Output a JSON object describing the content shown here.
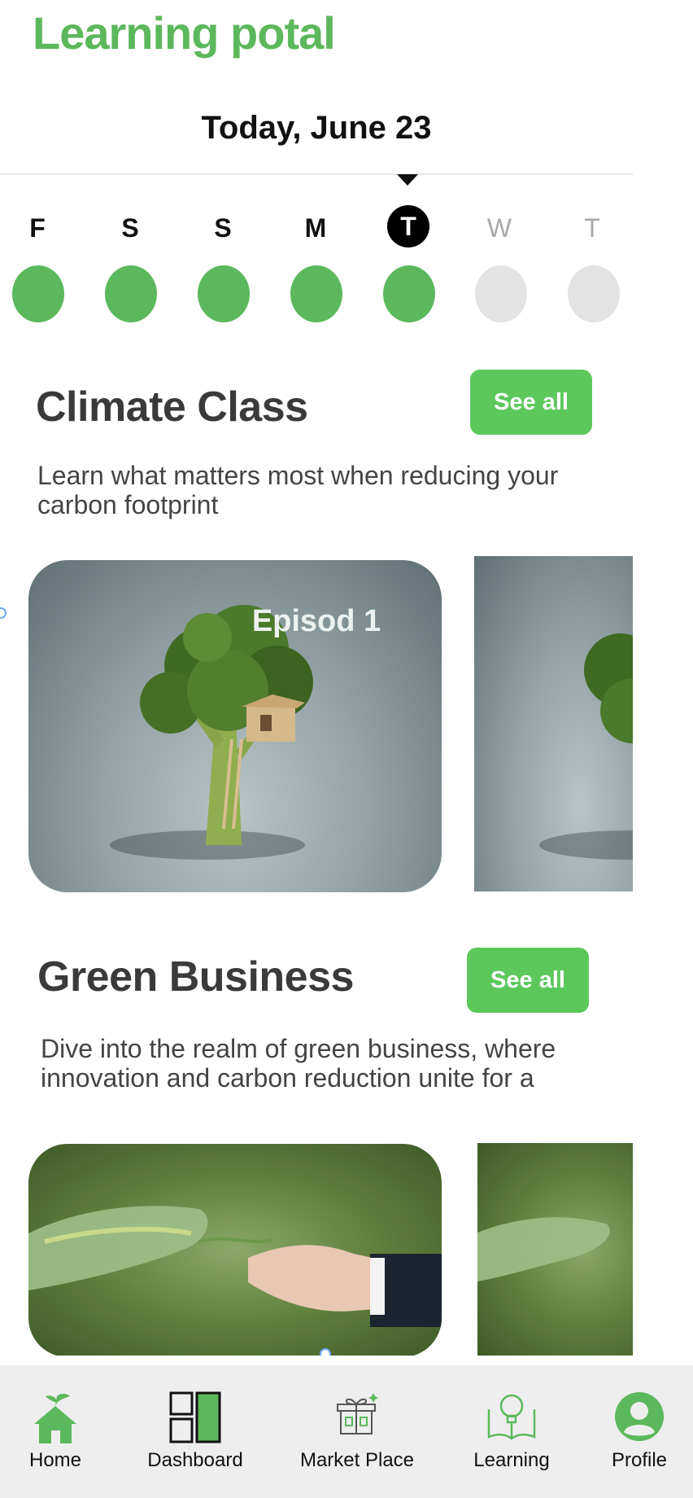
{
  "header": {
    "app_title": "Learning potal",
    "date": "Today, June 23"
  },
  "week": {
    "days": [
      {
        "letter": "F",
        "done": true
      },
      {
        "letter": "S",
        "done": true
      },
      {
        "letter": "S",
        "done": true
      },
      {
        "letter": "M",
        "done": true
      },
      {
        "letter": "T",
        "done": true,
        "today": true
      },
      {
        "letter": "W",
        "done": false
      },
      {
        "letter": "T",
        "done": false
      }
    ]
  },
  "sections": [
    {
      "title": "Climate Class",
      "see_all": "See all",
      "description": "Learn what matters most when reducing your carbon footprint",
      "cards": [
        {
          "label": "Episod 1",
          "image": "broccoli-treehouse"
        },
        {
          "label": "",
          "image": "broccoli-treehouse"
        }
      ]
    },
    {
      "title": "Green Business",
      "see_all": "See all",
      "description": "Dive into the realm of green business, where innovation and carbon reduction unite for a",
      "cards": [
        {
          "label": "",
          "image": "leaf-hand-handshake"
        },
        {
          "label": "",
          "image": "leaf-hand-handshake"
        }
      ]
    }
  ],
  "colors": {
    "accent": "#5cb85c",
    "button": "#5cc85c",
    "tabbar": "#eeeeee",
    "inactive_dot": "#e3e3e3"
  },
  "tabbar": [
    {
      "label": "Home",
      "icon": "home-icon"
    },
    {
      "label": "Dashboard",
      "icon": "dashboard-icon"
    },
    {
      "label": "Market Place",
      "icon": "gift-store-icon"
    },
    {
      "label": "Learning",
      "icon": "book-bulb-icon"
    },
    {
      "label": "Profile",
      "icon": "user-avatar-icon"
    }
  ]
}
